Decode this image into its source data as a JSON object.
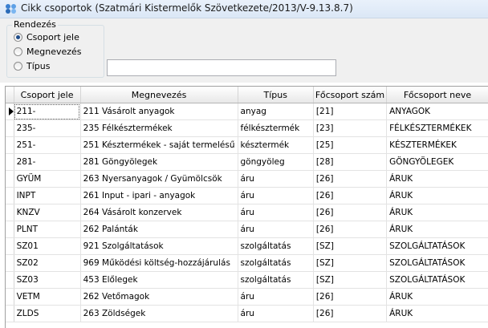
{
  "window": {
    "title": "Cikk csoportok (Szatmári Kistermelők Szövetkezete/2013/V-9.13.8.7)"
  },
  "sort_group": {
    "legend": "Rendezés",
    "options": [
      {
        "label": "Csoport jele",
        "checked": true
      },
      {
        "label": "Megnevezés",
        "checked": false
      },
      {
        "label": "Típus",
        "checked": false
      }
    ]
  },
  "search": {
    "value": ""
  },
  "table": {
    "columns": [
      "Csoport jele",
      "Megnevezés",
      "Típus",
      "Főcsoport szám",
      "Főcsoport neve"
    ],
    "rows": [
      [
        "211-",
        "211  Vásárolt anyagok",
        "anyag",
        "[21]",
        "ANYAGOK"
      ],
      [
        "235-",
        "235  Félkésztermékek",
        "félkésztermék",
        "[23]",
        "FÉLKÉSZTERMÉKEK"
      ],
      [
        "251-",
        "251  Késztermékek - saját termelésű",
        "késztermék",
        "[25]",
        "KÉSZTERMÉKEK"
      ],
      [
        "281-",
        "281  Göngyölegek",
        "göngyöleg",
        "[28]",
        "GÖNGYÖLEGEK"
      ],
      [
        "GYÜM",
        "263  Nyersanyagok / Gyümölcsök",
        "áru",
        "[26]",
        "ÁRUK"
      ],
      [
        "INPT",
        "261  Input - ipari - anyagok",
        "áru",
        "[26]",
        "ÁRUK"
      ],
      [
        "KNZV",
        "264  Vásárolt konzervek",
        "áru",
        "[26]",
        "ÁRUK"
      ],
      [
        "PLNT",
        "262  Palánták",
        "áru",
        "[26]",
        "ÁRUK"
      ],
      [
        "SZ01",
        "921 Szolgáltatások",
        "szolgáltatás",
        "[SZ]",
        "SZOLGÁLTATÁSOK"
      ],
      [
        "SZ02",
        "969  Működési költség-hozzájárulás",
        "szolgáltatás",
        "[SZ]",
        "SZOLGÁLTATÁSOK"
      ],
      [
        "SZ03",
        "453  Előlegek",
        "szolgáltatás",
        "[SZ]",
        "SZOLGÁLTATÁSOK"
      ],
      [
        "VETM",
        "262  Vetőmagok",
        "áru",
        "[26]",
        "ÁRUK"
      ],
      [
        "ZLDS",
        "263  Zöldségek",
        "áru",
        "[26]",
        "ÁRUK"
      ]
    ],
    "current_row": 0
  }
}
